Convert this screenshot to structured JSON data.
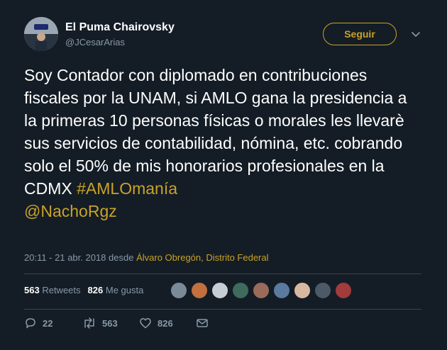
{
  "user": {
    "name": "El Puma Chairovsky",
    "handle": "@JCesarArias"
  },
  "follow_label": "Seguir",
  "tweet": {
    "text": "Soy Contador con diplomado en contribuciones fiscales por la UNAM, si AMLO gana la presidencia a la primeras 10 personas físicas o morales les llevarè sus servicios de contabilidad, nómina, etc. cobrando solo el 50% de mis honorarios profesionales en la CDMX ",
    "hashtag": "#AMLOmanía",
    "mention": "@NachoRgz"
  },
  "meta": {
    "time": "20:11 - 21 abr. 2018",
    "from_label": "desde",
    "place": "Álvaro Obregón, Distrito Federal"
  },
  "stats": {
    "retweets_count": "563",
    "retweets_label": "Retweets",
    "likes_count": "826",
    "likes_label": "Me gusta"
  },
  "likers": [
    {
      "icon": "liker-avatar-1",
      "color": "#7b8a99"
    },
    {
      "icon": "liker-avatar-2",
      "color": "#c2703d"
    },
    {
      "icon": "liker-avatar-3",
      "color": "#c6cdd4"
    },
    {
      "icon": "liker-avatar-4",
      "color": "#3f6b5e"
    },
    {
      "icon": "liker-avatar-5",
      "color": "#9a6b5a"
    },
    {
      "icon": "liker-avatar-6",
      "color": "#5a7aa0"
    },
    {
      "icon": "liker-avatar-7",
      "color": "#d9b8a0"
    },
    {
      "icon": "liker-avatar-8",
      "color": "#4c5966"
    },
    {
      "icon": "liker-avatar-9",
      "color": "#a23b3b"
    }
  ],
  "actions": {
    "replies": "22",
    "retweets": "563",
    "likes": "826"
  },
  "colors": {
    "background": "#141d26",
    "accent": "#c9a227",
    "muted": "#8899a6",
    "divider": "#38444d"
  }
}
